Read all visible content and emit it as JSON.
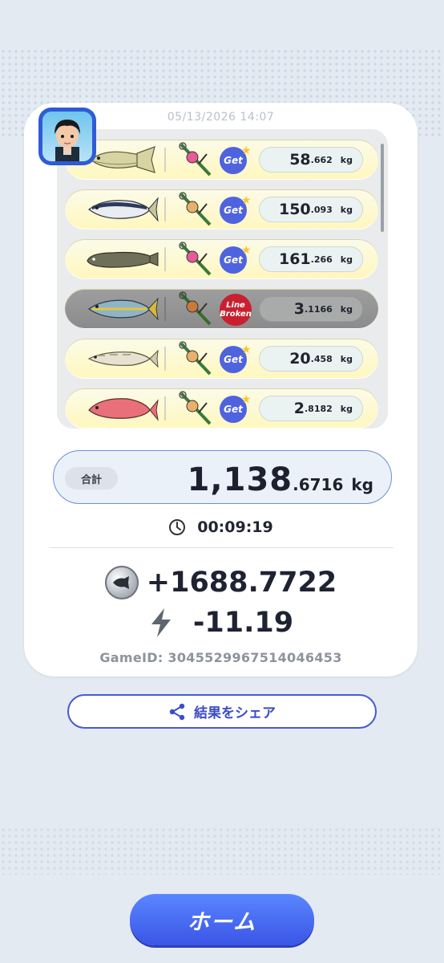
{
  "header": {
    "timestamp": "05/13/2026 14:07"
  },
  "catches": [
    {
      "fish": "yellowtail-fish",
      "status": "Get",
      "weight_int": "58",
      "weight_dec": ".662",
      "unit": "kg"
    },
    {
      "fish": "tuna-fish",
      "status": "Get",
      "weight_int": "150",
      "weight_dec": ".093",
      "unit": "kg"
    },
    {
      "fish": "catfish-fish",
      "status": "Get",
      "weight_int": "161",
      "weight_dec": ".266",
      "unit": "kg"
    },
    {
      "fish": "amberjack-fish",
      "status": "Line Broken",
      "broken_line1": "Line",
      "broken_line2": "Broken",
      "weight_int": "3",
      "weight_dec": ".1166",
      "unit": "kg"
    },
    {
      "fish": "salmon-fish",
      "status": "Get",
      "weight_int": "20",
      "weight_dec": ".458",
      "unit": "kg"
    },
    {
      "fish": "sea-bream-fish",
      "status": "Get",
      "weight_int": "2",
      "weight_dec": ".8182",
      "unit": "kg"
    }
  ],
  "total": {
    "label": "合計",
    "int": "1,138",
    "dec": ".6716",
    "unit": "kg"
  },
  "timer": {
    "value": "00:09:19"
  },
  "rewards": {
    "coins": "+1688.7722",
    "energy": "-11.19"
  },
  "game": {
    "id_text": "GameID: 3045529967514046453"
  },
  "buttons": {
    "share": "結果をシェア",
    "home": "ホーム"
  },
  "colors": {
    "accent": "#4659d6",
    "get_badge": "#4f63df",
    "broken_badge": "#c9202f"
  }
}
